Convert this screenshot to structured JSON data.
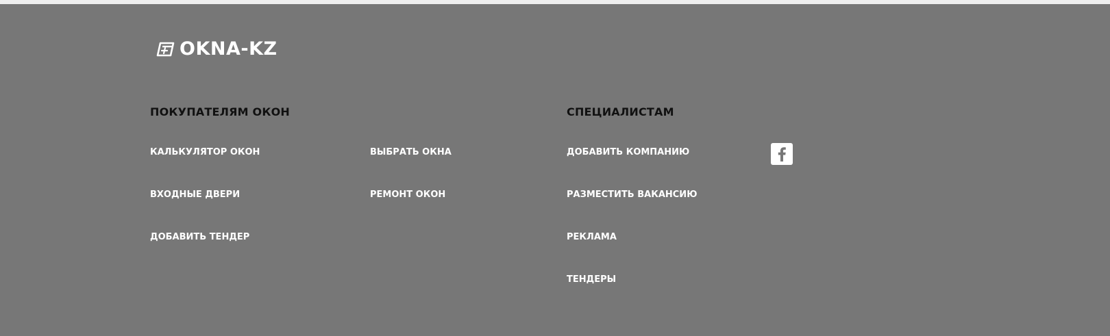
{
  "brand": {
    "logo_text": "OKNA-KZ",
    "logo_icon": "window-plus-logo-icon"
  },
  "buyers": {
    "heading": "ПОКУПАТЕЛЯМ ОКОН",
    "links": [
      "КАЛЬКУЛЯТОР ОКОН",
      "ВЫБРАТЬ ОКНА",
      "ВХОДНЫЕ ДВЕРИ",
      "РЕМОНТ ОКОН",
      "ДОБАВИТЬ ТЕНДЕР"
    ]
  },
  "specialists": {
    "heading": "СПЕЦИАЛИСТАМ",
    "links": [
      "ДОБАВИТЬ КОМПАНИЮ",
      "РАЗМЕСТИТЬ ВАКАНСИЮ",
      "РЕКЛАМА",
      "ТЕНДЕРЫ"
    ]
  },
  "social": {
    "icon": "facebook-icon"
  },
  "colors": {
    "background": "#777777",
    "topbar": "#eeeeee",
    "heading": "#111111",
    "link": "#ffffff"
  }
}
